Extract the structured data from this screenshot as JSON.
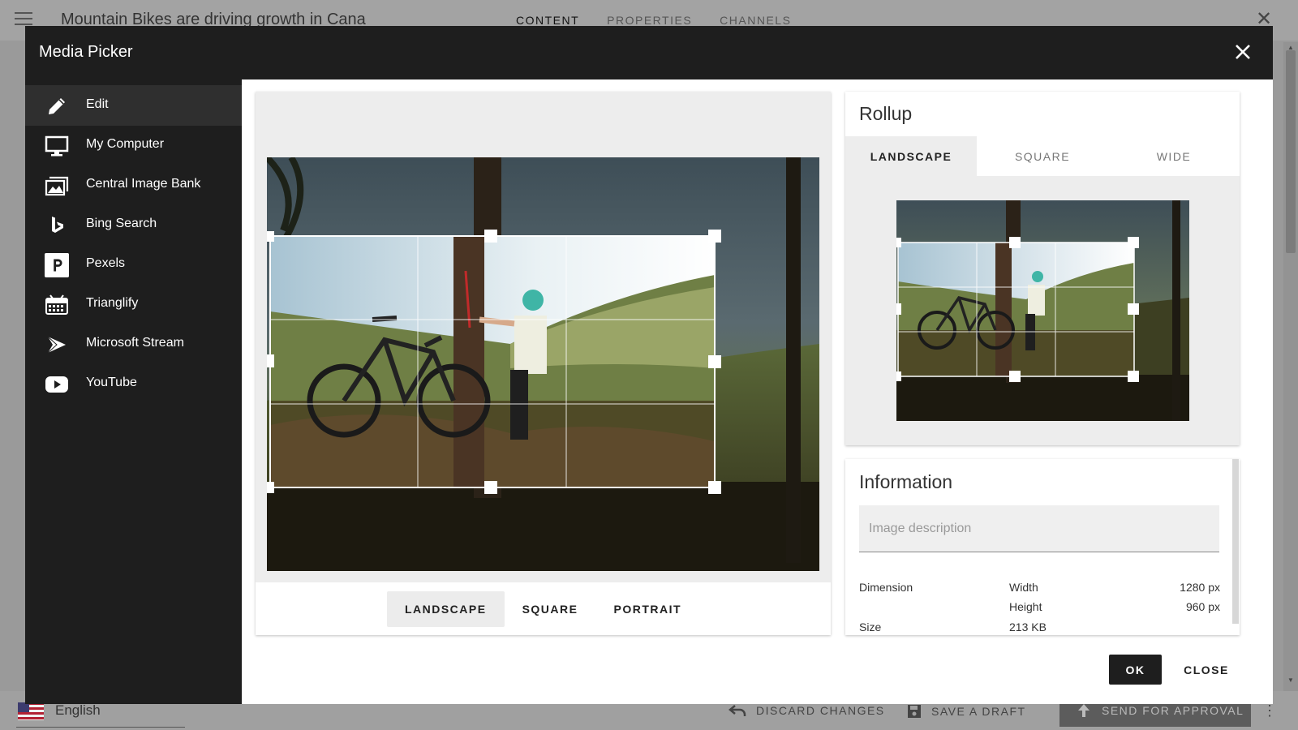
{
  "background": {
    "title": "Mountain Bikes are driving growth in Cana",
    "tabs": [
      "CONTENT",
      "PROPERTIES",
      "CHANNELS"
    ],
    "active_tab": "CONTENT",
    "language": "English",
    "actions": {
      "discard": "DISCARD CHANGES",
      "save_draft": "SAVE A DRAFT",
      "send_approval": "SEND FOR APPROVAL"
    }
  },
  "modal": {
    "title": "Media Picker",
    "sidebar": {
      "items": [
        {
          "label": "Edit",
          "icon": "pencil-icon"
        },
        {
          "label": "My Computer",
          "icon": "monitor-icon"
        },
        {
          "label": "Central Image Bank",
          "icon": "image-bank-icon"
        },
        {
          "label": "Bing Search",
          "icon": "bing-icon"
        },
        {
          "label": "Pexels",
          "icon": "pexels-icon"
        },
        {
          "label": "Trianglify",
          "icon": "trianglify-icon"
        },
        {
          "label": "Microsoft Stream",
          "icon": "stream-icon"
        },
        {
          "label": "YouTube",
          "icon": "youtube-icon"
        }
      ],
      "active": "Edit"
    },
    "editor": {
      "tabs": [
        "LANDSCAPE",
        "SQUARE",
        "PORTRAIT"
      ],
      "active_tab": "LANDSCAPE"
    },
    "rollup": {
      "title": "Rollup",
      "tabs": [
        "LANDSCAPE",
        "SQUARE",
        "WIDE"
      ],
      "active_tab": "LANDSCAPE"
    },
    "information": {
      "title": "Information",
      "description_placeholder": "Image description",
      "dimension_label": "Dimension",
      "width_label": "Width",
      "width_value": "1280 px",
      "height_label": "Height",
      "height_value": "960 px",
      "size_label": "Size",
      "size_value": "213 KB"
    },
    "buttons": {
      "ok": "OK",
      "close": "CLOSE"
    }
  },
  "colors": {
    "modal_dark": "#1e1e1e",
    "sidebar_active": "#2f2f2f",
    "panel_gray": "#ededed"
  }
}
